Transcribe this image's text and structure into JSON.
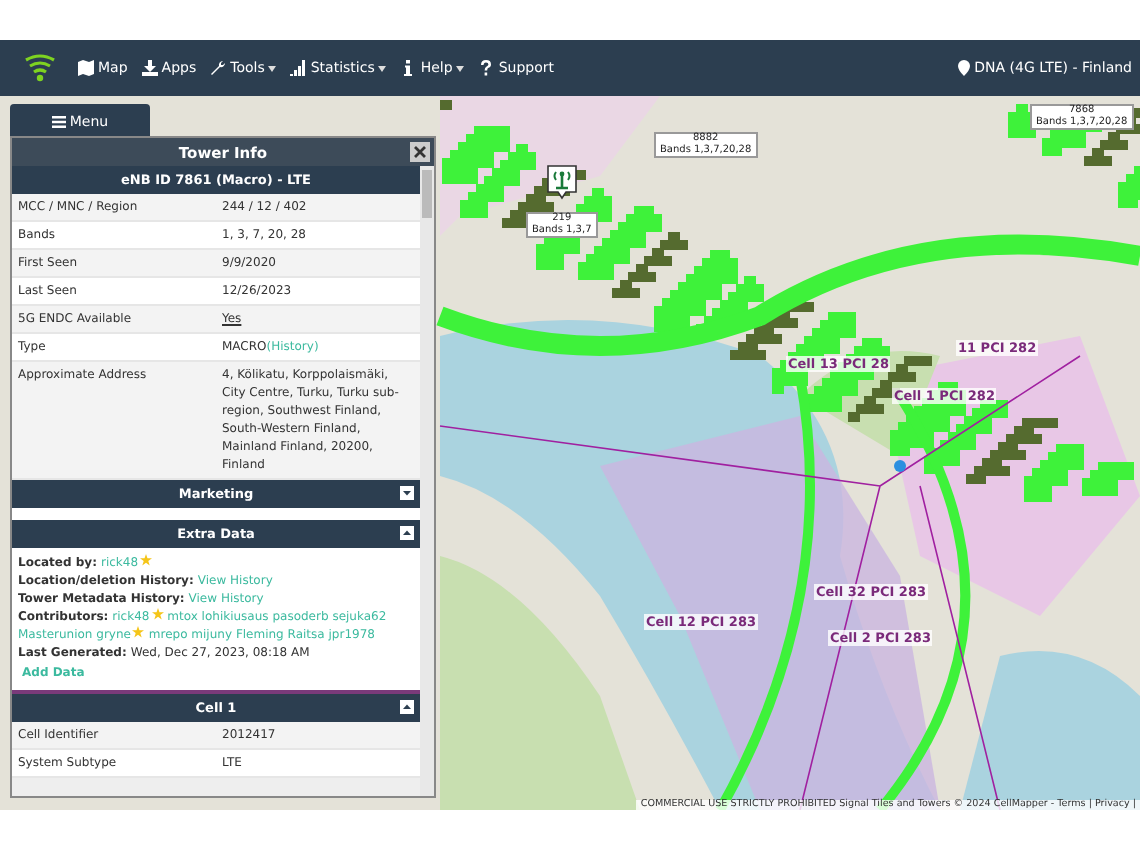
{
  "navbar": {
    "items": [
      {
        "label": "Map",
        "dropdown": false
      },
      {
        "label": "Apps",
        "dropdown": false
      },
      {
        "label": "Tools",
        "dropdown": true
      },
      {
        "label": "Statistics",
        "dropdown": true
      },
      {
        "label": "Help",
        "dropdown": true
      },
      {
        "label": "Support",
        "dropdown": false
      }
    ],
    "network": "DNA (4G LTE) - Finland"
  },
  "menu_button": "Menu",
  "tower_info": {
    "title": "Tower Info",
    "header": "eNB ID 7861 (Macro) - LTE",
    "rows": [
      {
        "label": "MCC / MNC / Region",
        "value": "244 / 12 / 402",
        "kind": "text"
      },
      {
        "label": "Bands",
        "value": "1, 3, 7, 20, 28",
        "kind": "text"
      },
      {
        "label": "First Seen",
        "value": "9/9/2020",
        "kind": "text"
      },
      {
        "label": "Last Seen",
        "value": "12/26/2023",
        "kind": "text"
      },
      {
        "label": "5G ENDC Available",
        "value": "Yes",
        "kind": "underlined"
      },
      {
        "label": "Type",
        "value": "MACRO",
        "link": "(History)",
        "kind": "text"
      },
      {
        "label": "Approximate Address",
        "value": "4, Kölikatu, Korppolaismäki, City Centre, Turku, Turku sub-region, Southwest Finland, South-Western Finland, Mainland Finland, 20200, Finland",
        "kind": "text"
      }
    ],
    "marketing": {
      "title": "Marketing",
      "expanded": false
    },
    "extra_data": {
      "title": "Extra Data",
      "expanded": true,
      "lines": [
        {
          "label": "Located by:",
          "parts": [
            {
              "text": "rick48",
              "star": true
            }
          ]
        },
        {
          "label": "Location/deletion History:",
          "parts": [
            {
              "text": "View History",
              "star": false
            }
          ]
        },
        {
          "label": "Tower Metadata History:",
          "parts": [
            {
              "text": "View History",
              "star": false
            }
          ]
        },
        {
          "label": "Contributors:",
          "parts": [
            {
              "text": "rick48",
              "star": true
            },
            {
              "text": "mtox",
              "star": false
            },
            {
              "text": "lohikiusaus",
              "star": false
            },
            {
              "text": "pasoderb",
              "star": false
            },
            {
              "text": "sejuka62",
              "star": false
            },
            {
              "text": "Masterunion gryne",
              "star": true
            },
            {
              "text": "mrepo",
              "star": false
            },
            {
              "text": "mijuny",
              "star": false
            },
            {
              "text": "Fleming",
              "star": false
            },
            {
              "text": "Raitsa",
              "star": false
            },
            {
              "text": "jpr1978",
              "star": false
            }
          ]
        },
        {
          "label": "Last Generated:",
          "value": "Wed, Dec 27, 2023, 08:18 AM"
        }
      ],
      "add_button": "Add Data"
    },
    "cell": {
      "title": "Cell 1",
      "expanded": true,
      "rows": [
        {
          "label": "Cell Identifier",
          "value": "2012417"
        },
        {
          "label": "System Subtype",
          "value": "LTE"
        }
      ]
    }
  },
  "map": {
    "towers": [
      {
        "id": "8882",
        "bands": "Bands 1,3,7,20,28"
      },
      {
        "id": "219",
        "bands": "Bands 1,3,7"
      },
      {
        "id": "7868",
        "bands": "Bands 1,3,7,20,28"
      }
    ],
    "cell_labels": [
      "11 PCI 282",
      "Cell 13 PCI 28",
      "Cell 1 PCI 282",
      "Cell 32 PCI 283",
      "Cell 12 PCI 283",
      "Cell 2 PCI 283"
    ],
    "attribution": "COMMERCIAL USE STRICTLY PROHIBITED Signal Tiles and Towers © 2024 CellMapper - Terms | Privacy |"
  }
}
